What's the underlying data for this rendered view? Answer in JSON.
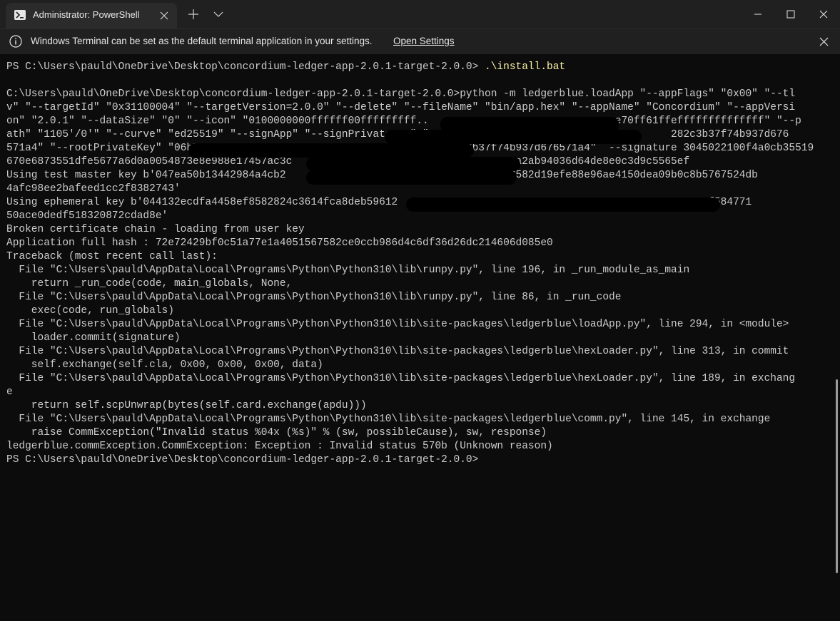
{
  "window": {
    "tab_title": "Administrator: PowerShell",
    "icons": {
      "tab": "powershell-icon",
      "close_tab": "close-icon",
      "new_tab": "plus-icon",
      "dropdown": "chevron-down-icon",
      "minimize": "minimize-icon",
      "maximize": "maximize-icon",
      "close": "close-icon"
    }
  },
  "infobar": {
    "message": "Windows Terminal can be set as the default terminal application in your settings.",
    "link": "Open Settings",
    "icons": {
      "info": "info-icon",
      "close": "close-icon"
    }
  },
  "colors": {
    "background": "#0c0c0c",
    "titlebar": "#202020",
    "text": "#cccccc",
    "command": "#f9f1a5"
  },
  "terminal": {
    "prompt1": "PS C:\\Users\\pauld\\OneDrive\\Desktop\\concordium-ledger-app-2.0.1-target-2.0.0> ",
    "cmd1": ".\\install.bat",
    "lines": [
      "",
      "C:\\Users\\pauld\\OneDrive\\Desktop\\concordium-ledger-app-2.0.1-target-2.0.0>python -m ledgerblue.loadApp \"--appFlags\" \"0x00\" \"--tl",
      "v\" \"--targetId\" \"0x31100004\" \"--targetVersion=2.0.0\" \"--delete\" \"--fileName\" \"bin/app.hex\" \"--appName\" \"Concordium\" \"--appVersi",
      "on\" \"2.0.1\" \"--dataSize\" \"0\" \"--icon\" \"0100000000ffffff00fffffffff..                           ...e70ff61ffeffffffffffffff\" \"--p",
      "ath\" \"1105'/0'\" \"--curve\" \"ed25519\" \"--signApp\" \"--signPrivateKey\" \"06b712c91d                             282c3b37f74b937d676",
      "571a4\" \"--rootPrivateKey\" \"06b712c9                                     2c3b37f74b937d676571a4\"  --signature 3045022100f4a0cb35519",
      "670e6873551dfe5677a6d0a0054873e8e988e17457ac3c                          2301862206a2ab94036d64de8e0c3d9c5565ef",
      "Using test master key b'047ea50b13442984a4cb2                                 78d6582d19efe88e96ae4150dea09b0c8b5767524db",
      "4afc98ee2bafeed1cc2f8382743'",
      "Using ephemeral key b'044132ecdfa4458ef8582824c3614fca8deb59612                                         099a0c1a9f584771",
      "50ace0dedf518320872cdad8e'",
      "Broken certificate chain - loading from user key",
      "Application full hash : 72e72429bf0c51a77e1a4051567582ce0ccb986d4c6df36d26dc214606d085e0",
      "Traceback (most recent call last):",
      "  File \"C:\\Users\\pauld\\AppData\\Local\\Programs\\Python\\Python310\\lib\\runpy.py\", line 196, in _run_module_as_main",
      "    return _run_code(code, main_globals, None,",
      "  File \"C:\\Users\\pauld\\AppData\\Local\\Programs\\Python\\Python310\\lib\\runpy.py\", line 86, in _run_code",
      "    exec(code, run_globals)",
      "  File \"C:\\Users\\pauld\\AppData\\Local\\Programs\\Python\\Python310\\lib\\site-packages\\ledgerblue\\loadApp.py\", line 294, in <module>",
      "    loader.commit(signature)",
      "  File \"C:\\Users\\pauld\\AppData\\Local\\Programs\\Python\\Python310\\lib\\site-packages\\ledgerblue\\hexLoader.py\", line 313, in commit",
      "    self.exchange(self.cla, 0x00, 0x00, 0x00, data)",
      "  File \"C:\\Users\\pauld\\AppData\\Local\\Programs\\Python\\Python310\\lib\\site-packages\\ledgerblue\\hexLoader.py\", line 189, in exchang",
      "e",
      "    return self.scpUnwrap(bytes(self.card.exchange(apdu)))",
      "  File \"C:\\Users\\pauld\\AppData\\Local\\Programs\\Python\\Python310\\lib\\site-packages\\ledgerblue\\comm.py\", line 145, in exchange",
      "    raise CommException(\"Invalid status %04x (%s)\" % (sw, possibleCause), sw, response)",
      "ledgerblue.commException.CommException: Exception : Invalid status 570b (Unknown reason)",
      "PS C:\\Users\\pauld\\OneDrive\\Desktop\\concordium-ledger-app-2.0.1-target-2.0.0>"
    ]
  }
}
